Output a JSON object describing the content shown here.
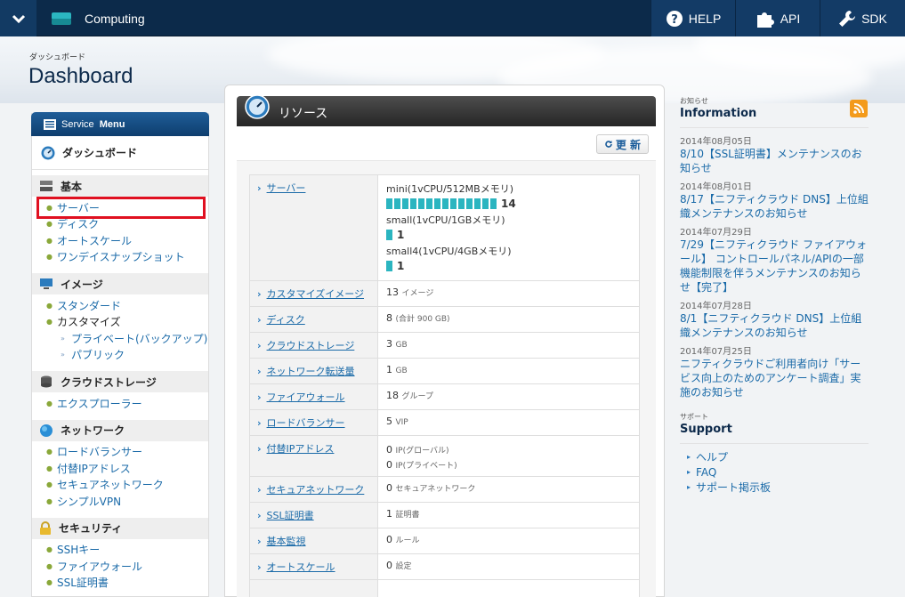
{
  "topbar": {
    "app_title": "Computing",
    "help_label": "HELP",
    "api_label": "API",
    "sdk_label": "SDK"
  },
  "header": {
    "subtitle": "ダッシュボード",
    "title": "Dashboard"
  },
  "sidebar": {
    "head_service": "Service",
    "head_menu": "Menu",
    "dashboard_label": "ダッシュボード",
    "sections": [
      {
        "title": "基本",
        "items": [
          "サーバー",
          "ディスク",
          "オートスケール",
          "ワンデイスナップショット"
        ]
      },
      {
        "title": "イメージ",
        "items": [
          "スタンダード",
          "カスタマイズ",
          "プライベート(バックアップ)",
          "パブリック"
        ]
      },
      {
        "title": "クラウドストレージ",
        "items": [
          "エクスプローラー"
        ]
      },
      {
        "title": "ネットワーク",
        "items": [
          "ロードバランサー",
          "付替IPアドレス",
          "セキュアネットワーク",
          "シンプルVPN"
        ]
      },
      {
        "title": "セキュリティ",
        "items": [
          "SSHキー",
          "ファイアウォール",
          "SSL証明書"
        ]
      }
    ]
  },
  "panel": {
    "title": "リソース",
    "refresh_label": "更 新",
    "server": {
      "label": "サーバー",
      "types": [
        {
          "spec": "mini(1vCPU/512MBメモリ)",
          "count": "14",
          "value": 14
        },
        {
          "spec": "small(1vCPU/1GBメモリ)",
          "count": "1",
          "value": 1
        },
        {
          "spec": "small4(1vCPU/4GBメモリ)",
          "count": "1",
          "value": 1
        }
      ]
    },
    "rows": [
      {
        "label": "カスタマイズイメージ",
        "value": "13",
        "unit": "イメージ"
      },
      {
        "label": "ディスク",
        "value": "8",
        "unit": "(合計 900 GB)"
      },
      {
        "label": "クラウドストレージ",
        "value": "3",
        "unit": "GB"
      },
      {
        "label": "ネットワーク転送量",
        "value": "1",
        "unit": "GB"
      },
      {
        "label": "ファイアウォール",
        "value": "18",
        "unit": "グループ"
      },
      {
        "label": "ロードバランサー",
        "value": "5",
        "unit": "VIP"
      }
    ],
    "ip_row": {
      "label": "付替IPアドレス",
      "global_value": "0",
      "global_unit": "IP(グローバル)",
      "private_value": "0",
      "private_unit": "IP(プライベート)"
    },
    "rows2": [
      {
        "label": "セキュアネットワーク",
        "value": "0",
        "unit": "セキュアネットワーク"
      },
      {
        "label": "SSL証明書",
        "value": "1",
        "unit": "証明書"
      },
      {
        "label": "基本監視",
        "value": "0",
        "unit": "ルール"
      },
      {
        "label": "オートスケール",
        "value": "0",
        "unit": "設定"
      }
    ]
  },
  "info": {
    "sub": "お知らせ",
    "title": "Information",
    "news": [
      {
        "date": "2014年08月05日",
        "text": "8/10【SSL証明書】メンテナンスのお知らせ"
      },
      {
        "date": "2014年08月01日",
        "text": "8/17【ニフティクラウド DNS】上位組織メンテナンスのお知らせ"
      },
      {
        "date": "2014年07月29日",
        "text": "7/29【ニフティクラウド ファイアウォール】 コントロールパネル/APIの一部機能制限を伴うメンテナンスのお知らせ【完了】"
      },
      {
        "date": "2014年07月28日",
        "text": "8/1【ニフティクラウド DNS】上位組織メンテナンスのお知らせ"
      },
      {
        "date": "2014年07月25日",
        "text": "ニフティクラウドご利用者向け「サービス向上のためのアンケート調査」実施のお知らせ"
      }
    ],
    "support_sub": "サポート",
    "support_title": "Support",
    "support_items": [
      "ヘルプ",
      "FAQ",
      "サポート掲示板"
    ]
  },
  "colors": {
    "topbar": "#0c2a4a",
    "accent_bar": "#2bb5c0",
    "link": "#1a6aa8",
    "selection_outline": "#e01020"
  }
}
